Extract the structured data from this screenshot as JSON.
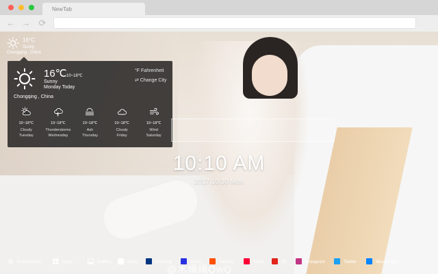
{
  "browser": {
    "tab_title": "NewTab",
    "nav": {
      "back": "←",
      "forward": "→",
      "reload": "⟳"
    }
  },
  "mini_weather": {
    "temp": "16°C",
    "condition": "Sunny",
    "location": "Chongqing , China",
    "icon": "sun-icon"
  },
  "weather_popup": {
    "temp": "16℃",
    "range": "10~18℃",
    "condition": "Sunny",
    "day": "Monday Today",
    "unit_toggle": "°F  Fahrenheit",
    "change_city": "⇄  Change City",
    "city": "Chongqing , China",
    "forecast": [
      {
        "icon": "cloud-sun-icon",
        "range": "10~18℃",
        "condition": "Cloudy",
        "day": "Tuesday"
      },
      {
        "icon": "thunderstorm-icon",
        "range": "10~18℃",
        "condition": "Thunderstorms",
        "day": "Wednesday"
      },
      {
        "icon": "haze-icon",
        "range": "10~18℃",
        "condition": "Ash",
        "day": "Thursday"
      },
      {
        "icon": "cloud-icon",
        "range": "10~18℃",
        "condition": "Cloudy",
        "day": "Friday"
      },
      {
        "icon": "wind-icon",
        "range": "10~18℃",
        "condition": "Wind",
        "day": "Saturday"
      }
    ]
  },
  "clock": {
    "time": "10:10 AM",
    "date": "2017.10.30 Mon"
  },
  "bottom_bar": [
    {
      "label": "Preferences",
      "icon": "gear-icon",
      "color": "#ffffff"
    },
    {
      "label": "Apps",
      "icon": "grid-icon",
      "color": "#ffffff"
    },
    {
      "label": "Gallery",
      "icon": "image-icon",
      "color": "#ffffff"
    },
    {
      "label": "eBay",
      "icon": "ebay-icon",
      "color": "#e53238"
    },
    {
      "label": "Booking",
      "icon": "booking-icon",
      "color": "#003580"
    },
    {
      "label": "Baidu",
      "icon": "baidu-icon",
      "color": "#2932e1"
    },
    {
      "label": "Taobao",
      "icon": "taobao-icon",
      "color": "#ff5000"
    },
    {
      "label": "Tmall",
      "icon": "tmall-icon",
      "color": "#ff0036"
    },
    {
      "label": "JD",
      "icon": "jd-icon",
      "color": "#e1251b"
    },
    {
      "label": "Instagram",
      "icon": "instagram-icon",
      "color": "#c13584"
    },
    {
      "label": "Twitter",
      "icon": "twitter-icon",
      "color": "#1da1f2"
    },
    {
      "label": "Messenger",
      "icon": "messenger-icon",
      "color": "#0084ff"
    }
  ],
  "watermark": "@木绳绳QwQ"
}
